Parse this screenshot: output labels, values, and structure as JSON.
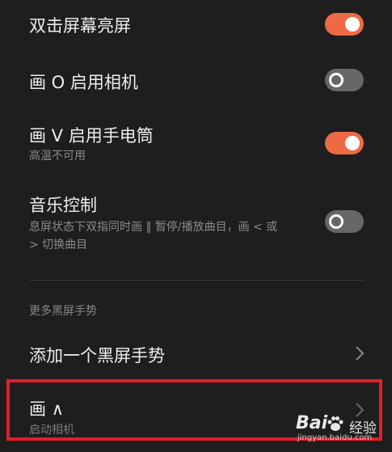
{
  "settings": [
    {
      "title": "双击屏幕亮屏",
      "subtitle": "",
      "toggle": "on"
    },
    {
      "title": "画 O 启用相机",
      "subtitle": "",
      "toggle": "off"
    },
    {
      "title": "画 V 启用手电筒",
      "subtitle": "高温不可用",
      "toggle": "on"
    },
    {
      "title": "音乐控制",
      "subtitle_line1": "息屏状态下双指同时画 ‖ 暂停/播放曲目，画 < 或",
      "subtitle_line2": "> 切换曲目",
      "toggle": "off"
    }
  ],
  "section": {
    "header": "更多黑屏手势"
  },
  "actions": [
    {
      "title": "添加一个黑屏手势",
      "subtitle": ""
    },
    {
      "title": "画 ∧",
      "subtitle": "启动相机"
    }
  ],
  "watermark": {
    "brand": "Bai",
    "brand_cn": "经验",
    "url": "jingyan.baidu.com"
  },
  "colors": {
    "accent": "#ee6a45",
    "toggle_off": "#676767",
    "highlight": "#e21f26",
    "background": "#1e1e1e"
  }
}
